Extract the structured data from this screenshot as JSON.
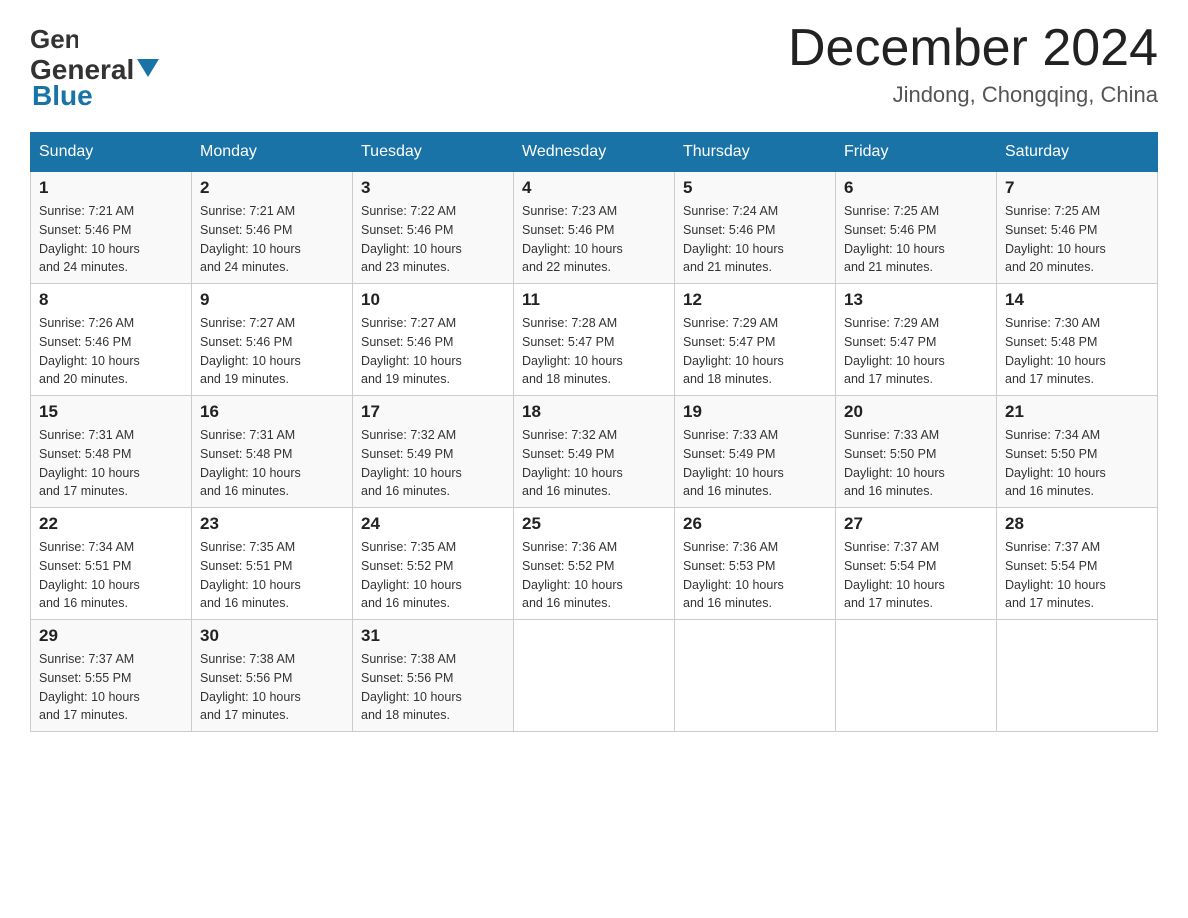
{
  "header": {
    "logo": {
      "general": "General",
      "blue": "Blue"
    },
    "title": "December 2024",
    "location": "Jindong, Chongqing, China"
  },
  "days_of_week": [
    "Sunday",
    "Monday",
    "Tuesday",
    "Wednesday",
    "Thursday",
    "Friday",
    "Saturday"
  ],
  "weeks": [
    [
      {
        "day": "1",
        "sunrise": "7:21 AM",
        "sunset": "5:46 PM",
        "daylight": "10 hours and 24 minutes."
      },
      {
        "day": "2",
        "sunrise": "7:21 AM",
        "sunset": "5:46 PM",
        "daylight": "10 hours and 24 minutes."
      },
      {
        "day": "3",
        "sunrise": "7:22 AM",
        "sunset": "5:46 PM",
        "daylight": "10 hours and 23 minutes."
      },
      {
        "day": "4",
        "sunrise": "7:23 AM",
        "sunset": "5:46 PM",
        "daylight": "10 hours and 22 minutes."
      },
      {
        "day": "5",
        "sunrise": "7:24 AM",
        "sunset": "5:46 PM",
        "daylight": "10 hours and 21 minutes."
      },
      {
        "day": "6",
        "sunrise": "7:25 AM",
        "sunset": "5:46 PM",
        "daylight": "10 hours and 21 minutes."
      },
      {
        "day": "7",
        "sunrise": "7:25 AM",
        "sunset": "5:46 PM",
        "daylight": "10 hours and 20 minutes."
      }
    ],
    [
      {
        "day": "8",
        "sunrise": "7:26 AM",
        "sunset": "5:46 PM",
        "daylight": "10 hours and 20 minutes."
      },
      {
        "day": "9",
        "sunrise": "7:27 AM",
        "sunset": "5:46 PM",
        "daylight": "10 hours and 19 minutes."
      },
      {
        "day": "10",
        "sunrise": "7:27 AM",
        "sunset": "5:46 PM",
        "daylight": "10 hours and 19 minutes."
      },
      {
        "day": "11",
        "sunrise": "7:28 AM",
        "sunset": "5:47 PM",
        "daylight": "10 hours and 18 minutes."
      },
      {
        "day": "12",
        "sunrise": "7:29 AM",
        "sunset": "5:47 PM",
        "daylight": "10 hours and 18 minutes."
      },
      {
        "day": "13",
        "sunrise": "7:29 AM",
        "sunset": "5:47 PM",
        "daylight": "10 hours and 17 minutes."
      },
      {
        "day": "14",
        "sunrise": "7:30 AM",
        "sunset": "5:48 PM",
        "daylight": "10 hours and 17 minutes."
      }
    ],
    [
      {
        "day": "15",
        "sunrise": "7:31 AM",
        "sunset": "5:48 PM",
        "daylight": "10 hours and 17 minutes."
      },
      {
        "day": "16",
        "sunrise": "7:31 AM",
        "sunset": "5:48 PM",
        "daylight": "10 hours and 16 minutes."
      },
      {
        "day": "17",
        "sunrise": "7:32 AM",
        "sunset": "5:49 PM",
        "daylight": "10 hours and 16 minutes."
      },
      {
        "day": "18",
        "sunrise": "7:32 AM",
        "sunset": "5:49 PM",
        "daylight": "10 hours and 16 minutes."
      },
      {
        "day": "19",
        "sunrise": "7:33 AM",
        "sunset": "5:49 PM",
        "daylight": "10 hours and 16 minutes."
      },
      {
        "day": "20",
        "sunrise": "7:33 AM",
        "sunset": "5:50 PM",
        "daylight": "10 hours and 16 minutes."
      },
      {
        "day": "21",
        "sunrise": "7:34 AM",
        "sunset": "5:50 PM",
        "daylight": "10 hours and 16 minutes."
      }
    ],
    [
      {
        "day": "22",
        "sunrise": "7:34 AM",
        "sunset": "5:51 PM",
        "daylight": "10 hours and 16 minutes."
      },
      {
        "day": "23",
        "sunrise": "7:35 AM",
        "sunset": "5:51 PM",
        "daylight": "10 hours and 16 minutes."
      },
      {
        "day": "24",
        "sunrise": "7:35 AM",
        "sunset": "5:52 PM",
        "daylight": "10 hours and 16 minutes."
      },
      {
        "day": "25",
        "sunrise": "7:36 AM",
        "sunset": "5:52 PM",
        "daylight": "10 hours and 16 minutes."
      },
      {
        "day": "26",
        "sunrise": "7:36 AM",
        "sunset": "5:53 PM",
        "daylight": "10 hours and 16 minutes."
      },
      {
        "day": "27",
        "sunrise": "7:37 AM",
        "sunset": "5:54 PM",
        "daylight": "10 hours and 17 minutes."
      },
      {
        "day": "28",
        "sunrise": "7:37 AM",
        "sunset": "5:54 PM",
        "daylight": "10 hours and 17 minutes."
      }
    ],
    [
      {
        "day": "29",
        "sunrise": "7:37 AM",
        "sunset": "5:55 PM",
        "daylight": "10 hours and 17 minutes."
      },
      {
        "day": "30",
        "sunrise": "7:38 AM",
        "sunset": "5:56 PM",
        "daylight": "10 hours and 17 minutes."
      },
      {
        "day": "31",
        "sunrise": "7:38 AM",
        "sunset": "5:56 PM",
        "daylight": "10 hours and 18 minutes."
      },
      null,
      null,
      null,
      null
    ]
  ],
  "labels": {
    "sunrise": "Sunrise:",
    "sunset": "Sunset:",
    "daylight": "Daylight:"
  }
}
